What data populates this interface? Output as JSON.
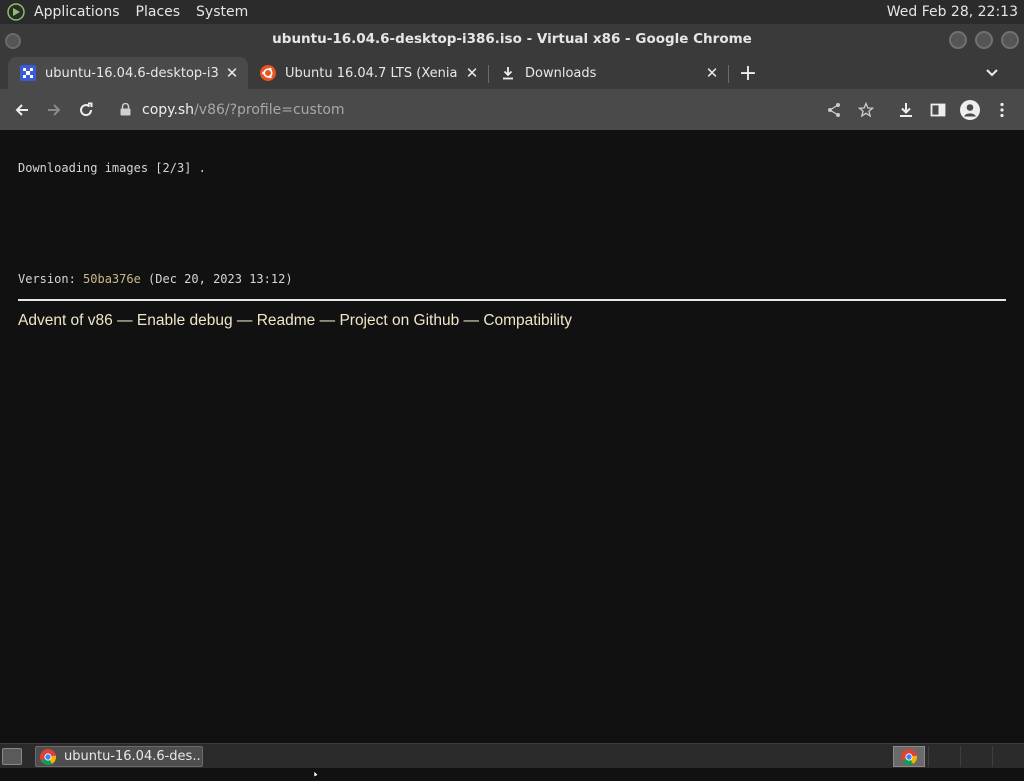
{
  "system_panel": {
    "menus": [
      "Applications",
      "Places",
      "System"
    ],
    "clock": "Wed Feb 28, 22:13"
  },
  "window": {
    "title": "ubuntu-16.04.6-desktop-i386.iso - Virtual x86 - Google Chrome"
  },
  "tabs": [
    {
      "title": "ubuntu-16.04.6-desktop-i386.iso - Virtual x86",
      "favicon": "v86-icon",
      "active": true
    },
    {
      "title": "Ubuntu 16.04.7 LTS (Xenial Xerus)",
      "favicon": "ubuntu-icon",
      "active": false
    },
    {
      "title": "Downloads",
      "favicon": "download-icon",
      "active": false
    }
  ],
  "toolbar": {
    "url_host": "copy.sh",
    "url_path": "/v86/?profile=custom"
  },
  "page": {
    "download_status": "Downloading images [2/3] .",
    "version_label": "Version: ",
    "version_hash": "50ba376e",
    "version_date": " (Dec 20, 2023 13:12)",
    "links": [
      "Advent of v86",
      "Enable debug",
      "Readme",
      "Project on Github",
      "Compatibility"
    ],
    "separator": " — "
  },
  "taskbar": {
    "task_label": "ubuntu-16.04.6-des..."
  },
  "colors": {
    "page_bg": "#111111",
    "link": "#f0e6c8",
    "version_hash": "#c9b98a",
    "chrome_frame": "#3a3a3a",
    "chrome_toolbar": "#4a4a4a"
  }
}
